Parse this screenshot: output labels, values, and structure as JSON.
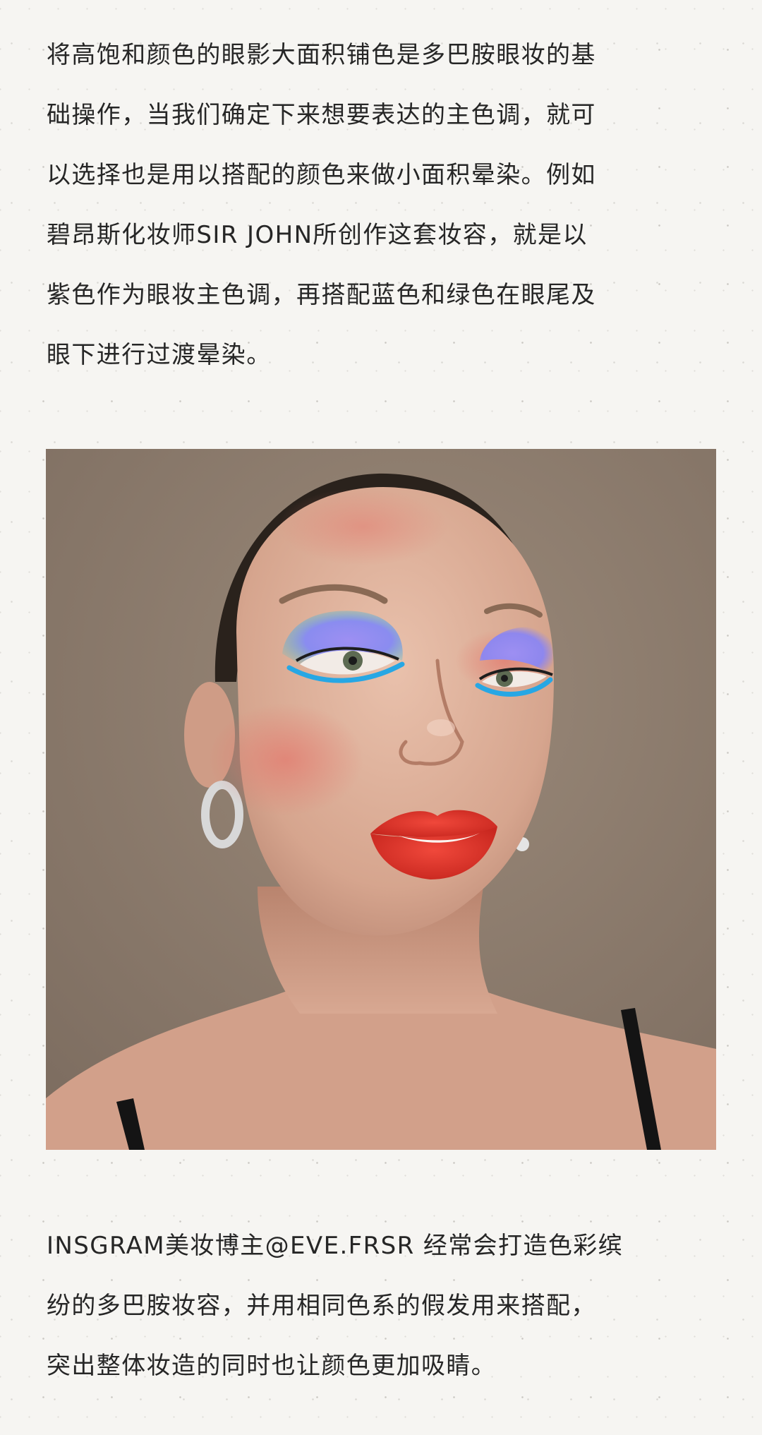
{
  "paragraph_1": {
    "lines": [
      "将高饱和颜色的眼影大面积铺色是多巴胺眼妆的基",
      "础操作，当我们确定下来想要表达的主色调，就可",
      "以选择也是用以搭配的颜色来做小面积晕染。例如",
      "碧昂斯化妆师SIR JOHN所创作这套妆容，就是以",
      "紫色作为眼妆主色调，再搭配蓝色和绿色在眼尾及",
      "眼下进行过渡晕染。"
    ]
  },
  "photo": {
    "icon": "portrait-photo-icon",
    "colors": {
      "background": "#8f7e6f",
      "skin": "#dcae98",
      "eyeshadow_purple": "#9b8ef0",
      "eyeshadow_blue": "#2fa9e6",
      "lips": "#e0342a",
      "hair": "#2a221c"
    }
  },
  "paragraph_2": {
    "lines": [
      "INSGRAM美妆博主@EVE.FRSR 经常会打造色彩缤",
      "纷的多巴胺妆容，并用相同色系的假发用来搭配，",
      "突出整体妆造的同时也让颜色更加吸睛。"
    ]
  },
  "colors": {
    "page_background": "#f6f5f2",
    "text": "#262626"
  }
}
